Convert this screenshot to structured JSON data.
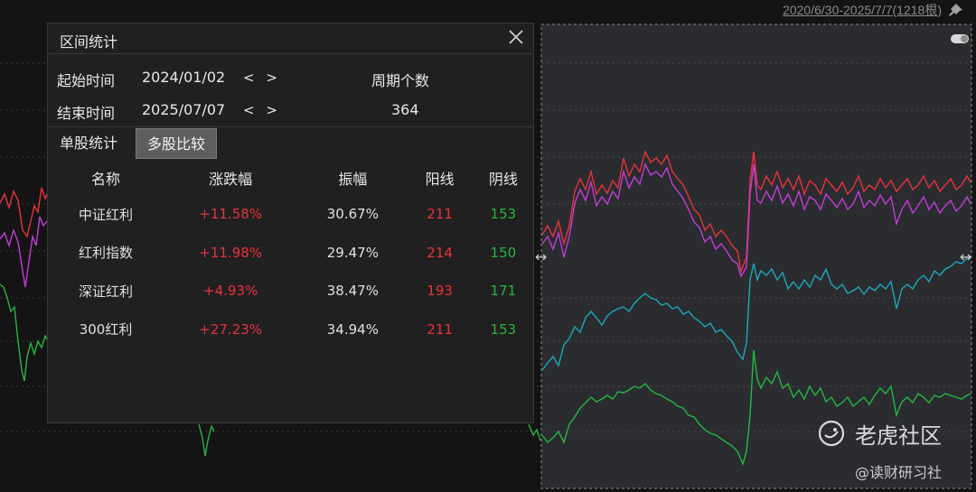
{
  "header": {
    "range": "2020/6/30-2025/7/7(1218根)",
    "pin_icon": "pin-icon"
  },
  "panel": {
    "title": "区间统计",
    "close_icon": "close-icon",
    "start_label": "起始时间",
    "start_date": "2024/01/02",
    "end_label": "结束时间",
    "end_date": "2025/07/07",
    "nav_arrows": "< >",
    "period_label": "周期个数",
    "period_count": "364",
    "tabs": [
      "单股统计",
      "多股比较"
    ],
    "columns": [
      "名称",
      "涨跌幅",
      "振幅",
      "阳线",
      "阴线"
    ],
    "rows": [
      {
        "name": "中证红利",
        "change": "+11.58%",
        "amplitude": "30.67%",
        "up": "211",
        "down": "153"
      },
      {
        "name": "红利指数",
        "change": "+11.98%",
        "amplitude": "29.47%",
        "up": "214",
        "down": "150"
      },
      {
        "name": "深证红利",
        "change": "+4.93%",
        "amplitude": "38.47%",
        "up": "193",
        "down": "171"
      },
      {
        "name": "300红利",
        "change": "+27.23%",
        "amplitude": "34.94%",
        "up": "211",
        "down": "153"
      }
    ]
  },
  "watermark": {
    "brand": "老虎社区",
    "sub": "@读财研习社"
  },
  "colors": {
    "red": "#e8333a",
    "magenta": "#c23dd6",
    "cyan": "#1fa7b8",
    "green": "#27b543"
  }
}
